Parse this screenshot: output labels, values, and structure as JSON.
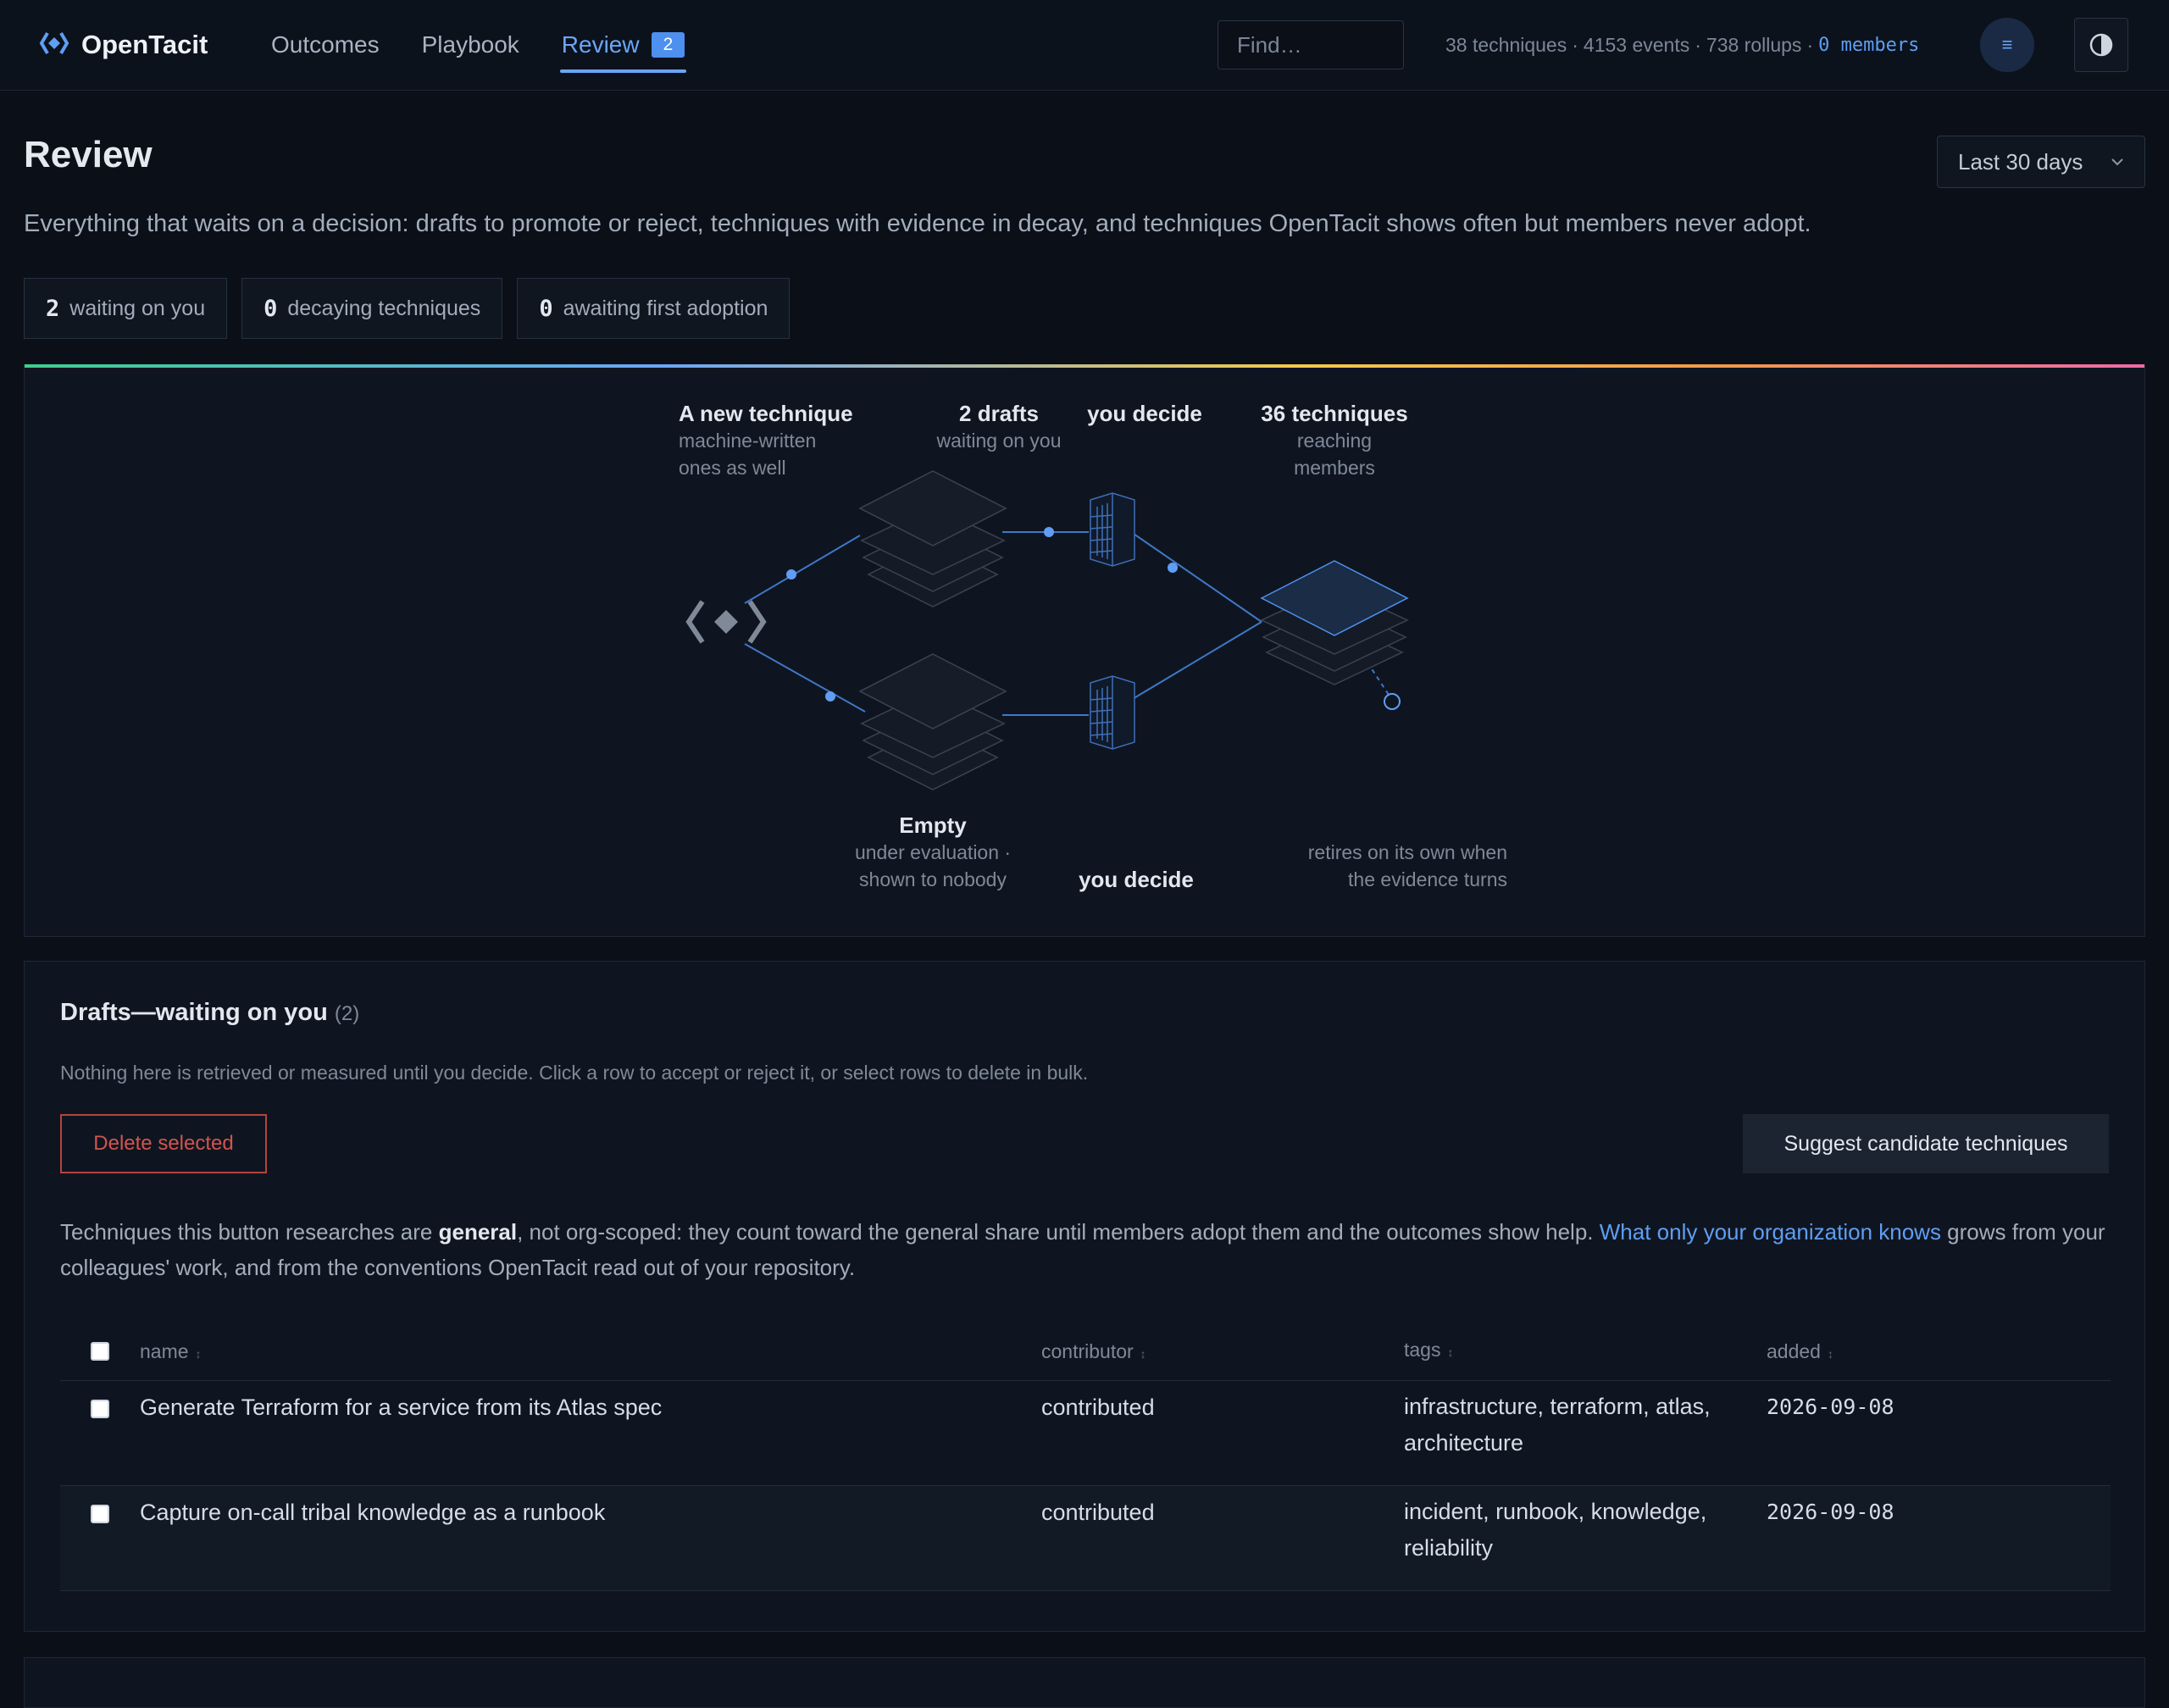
{
  "app": {
    "brand": "OpenTacit",
    "nav": [
      {
        "label": "Outcomes"
      },
      {
        "label": "Playbook"
      },
      {
        "label": "Review",
        "badge": "2",
        "active": true
      }
    ],
    "search_placeholder": "Find…",
    "stats": {
      "techniques": "38 techniques",
      "events": "4153 events",
      "rollups": "738 rollups",
      "members": "0 members"
    },
    "menu_icon": "≡"
  },
  "page": {
    "title": "Review",
    "range": "Last 30 days",
    "subtitle": "Everything that waits on a decision: drafts to promote or reject, techniques with evidence in decay, and techniques OpenTacit shows often but members never adopt.",
    "chips": [
      {
        "num": "2",
        "label": "waiting on you"
      },
      {
        "num": "0",
        "label": "decaying techniques"
      },
      {
        "num": "0",
        "label": "awaiting first adoption"
      }
    ]
  },
  "flow": {
    "new_title": "A new technique",
    "new_sub1": "machine-written",
    "new_sub2": "ones as well",
    "drafts_title": "2 drafts",
    "drafts_sub": "waiting on you",
    "decide_top": "you decide",
    "reach_title": "36 techniques",
    "reach_sub1": "reaching",
    "reach_sub2": "members",
    "empty_title": "Empty",
    "empty_sub1": "under evaluation ·",
    "empty_sub2": "shown to nobody",
    "decide_bottom": "you decide",
    "retire_1": "retires on its own when",
    "retire_2": "the evidence turns"
  },
  "drafts": {
    "title": "Drafts—waiting on you",
    "count": "(2)",
    "hint": "Nothing here is retrieved or measured until you decide. Click a row to accept or reject it, or select rows to delete in bulk.",
    "delete_label": "Delete selected",
    "suggest_label": "Suggest candidate techniques",
    "note_pre": "Techniques this button researches are ",
    "note_bold": "general",
    "note_mid": ", not org-scoped: they count toward the general share until members adopt them and the outcomes show help. ",
    "note_link": "What only your organization knows",
    "note_post": " grows from your colleagues' work, and from the conventions OpenTacit read out of your repository.",
    "columns": [
      "name",
      "contributor",
      "tags",
      "added"
    ],
    "rows": [
      {
        "name": "Generate Terraform for a service from its Atlas spec",
        "contributor": "contributed",
        "tags": "infrastructure, terraform, atlas, architecture",
        "added": "2026-09-08"
      },
      {
        "name": "Capture on-call tribal knowledge as a runbook",
        "contributor": "contributed",
        "tags": "incident, runbook, knowledge, reliability",
        "added": "2026-09-08"
      }
    ]
  }
}
